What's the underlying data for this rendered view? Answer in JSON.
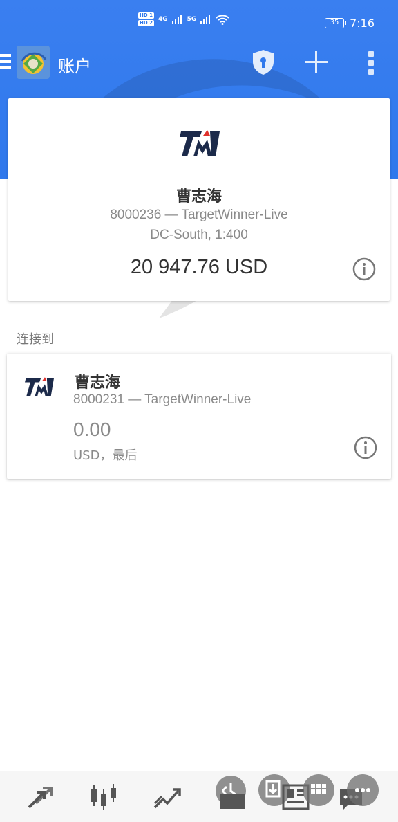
{
  "status_bar": {
    "hd1": "HD 1",
    "hd2": "HD 2",
    "net1": "4G",
    "net2": "5G",
    "battery": "35",
    "time": "7:16"
  },
  "app_bar": {
    "title": "账户",
    "icons": [
      "menu-icon",
      "metatrader-logo",
      "shield-lock-icon",
      "plus-icon",
      "more-vert-icon"
    ]
  },
  "main_account": {
    "logo": "TW",
    "name": "曹志海",
    "account_line": "8000236 — TargetWinner-Live",
    "server_line": "DC-South, 1:400",
    "balance": "20 947.76 USD"
  },
  "section": {
    "connected_to": "连接到"
  },
  "other_account": {
    "logo": "TW",
    "name": "曹志海",
    "account_line": "8000231 — TargetWinner-Live",
    "balance": "0.00",
    "sub_line": "USD，最后"
  },
  "bottom_nav": {
    "items": [
      "quotes-icon",
      "chart-icon",
      "trade-icon",
      "history-icon",
      "news-icon",
      "messages-icon"
    ]
  },
  "colors": {
    "header_blue": "#2f78ec",
    "tw_navy": "#1c2a4a",
    "tw_red": "#e0302b"
  }
}
